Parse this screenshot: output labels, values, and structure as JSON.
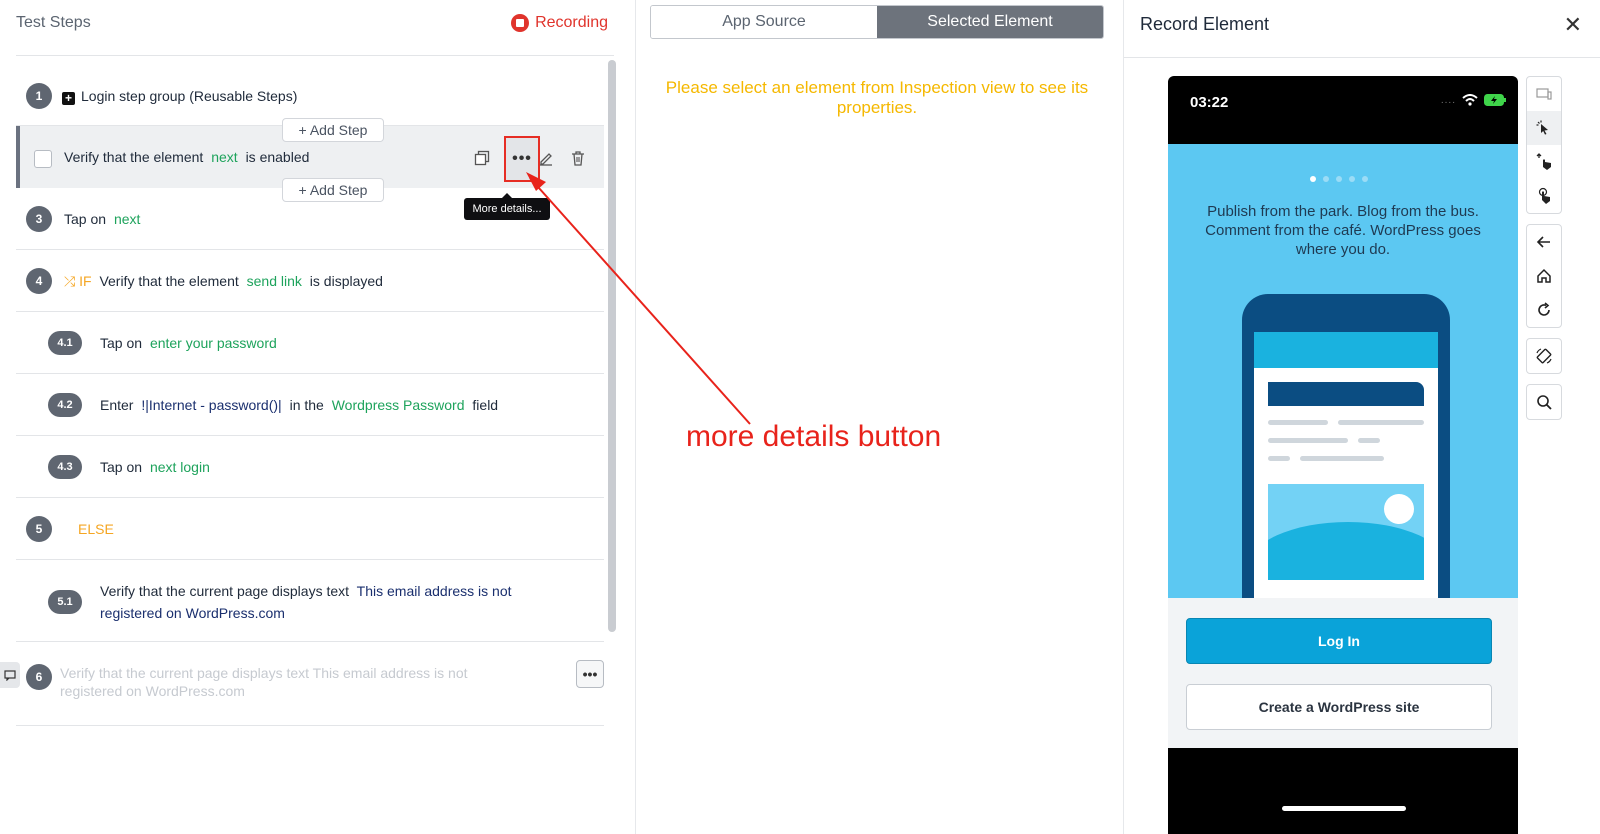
{
  "left_panel": {
    "title": "Test Steps",
    "recording_label": "Recording",
    "add_step_label": "+ Add Step",
    "tooltip": "More details...",
    "steps": [
      {
        "num": "1",
        "text": "Login step group (Reusable Steps)"
      },
      {
        "verb": "Verify that the element",
        "element": "next",
        "suffix": "is enabled"
      },
      {
        "num": "3",
        "verb": "Tap on",
        "element": "next"
      },
      {
        "num": "4",
        "keyword": "IF",
        "verb": "Verify that the element",
        "element": "send link",
        "suffix": "is displayed"
      },
      {
        "num": "4.1",
        "verb": "Tap on",
        "element": "enter your password"
      },
      {
        "num": "4.2",
        "verb": "Enter",
        "value": "!|Internet - password()|",
        "mid": "in the",
        "element": "Wordpress Password",
        "suffix": "field"
      },
      {
        "num": "4.3",
        "verb": "Tap on",
        "element": "next login"
      },
      {
        "num": "5",
        "keyword": "ELSE"
      },
      {
        "num": "5.1",
        "verb": "Verify that the current page displays text",
        "value": "This email address is not registered on WordPress.com"
      },
      {
        "num": "6",
        "text": "Verify that the current page displays text This email address is not registered on WordPress.com"
      }
    ]
  },
  "middle_panel": {
    "tabs": [
      "App Source",
      "Selected Element"
    ],
    "message": "Please select an element from Inspection view to see its properties."
  },
  "annotation": {
    "label": "more details button",
    "color": "#e8231b"
  },
  "right_panel": {
    "title": "Record Element",
    "close_label": "✕",
    "device": {
      "time": "03:22",
      "tagline": "Publish from the park. Blog from the bus. Comment from the café. WordPress goes where you do.",
      "login_label": "Log In",
      "create_label": "Create a WordPress site"
    },
    "toolbar_icons": [
      "device-icon",
      "pointer-icon",
      "swipe-icon",
      "tap-icon",
      "back-icon",
      "home-icon",
      "refresh-icon",
      "rotate-icon",
      "search-icon"
    ]
  },
  "colors": {
    "element": "#1ea35c",
    "keyword": "#f5a623",
    "value": "#1a2f6e",
    "recording": "#e0342c",
    "message": "#f5b800"
  }
}
